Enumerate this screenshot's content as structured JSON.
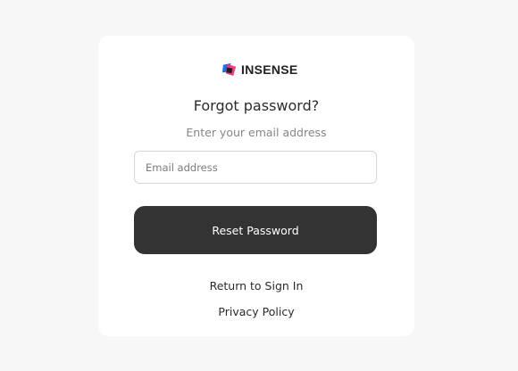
{
  "brand": {
    "name": "INSENSE",
    "logo_icon": "insense-logo-icon",
    "colors": {
      "blue": "#1e6fe6",
      "pink": "#f0327a",
      "dark": "#1f1f1f"
    }
  },
  "form": {
    "title": "Forgot password?",
    "subtitle": "Enter your email address",
    "email_placeholder": "Email address",
    "email_value": "",
    "submit_label": "Reset Password"
  },
  "links": {
    "return_label": "Return to Sign In",
    "privacy_label": "Privacy Policy"
  },
  "theme": {
    "page_background": "#f7f7f7",
    "card_background": "#ffffff",
    "button_background": "#333333",
    "button_text": "#ffffff"
  }
}
